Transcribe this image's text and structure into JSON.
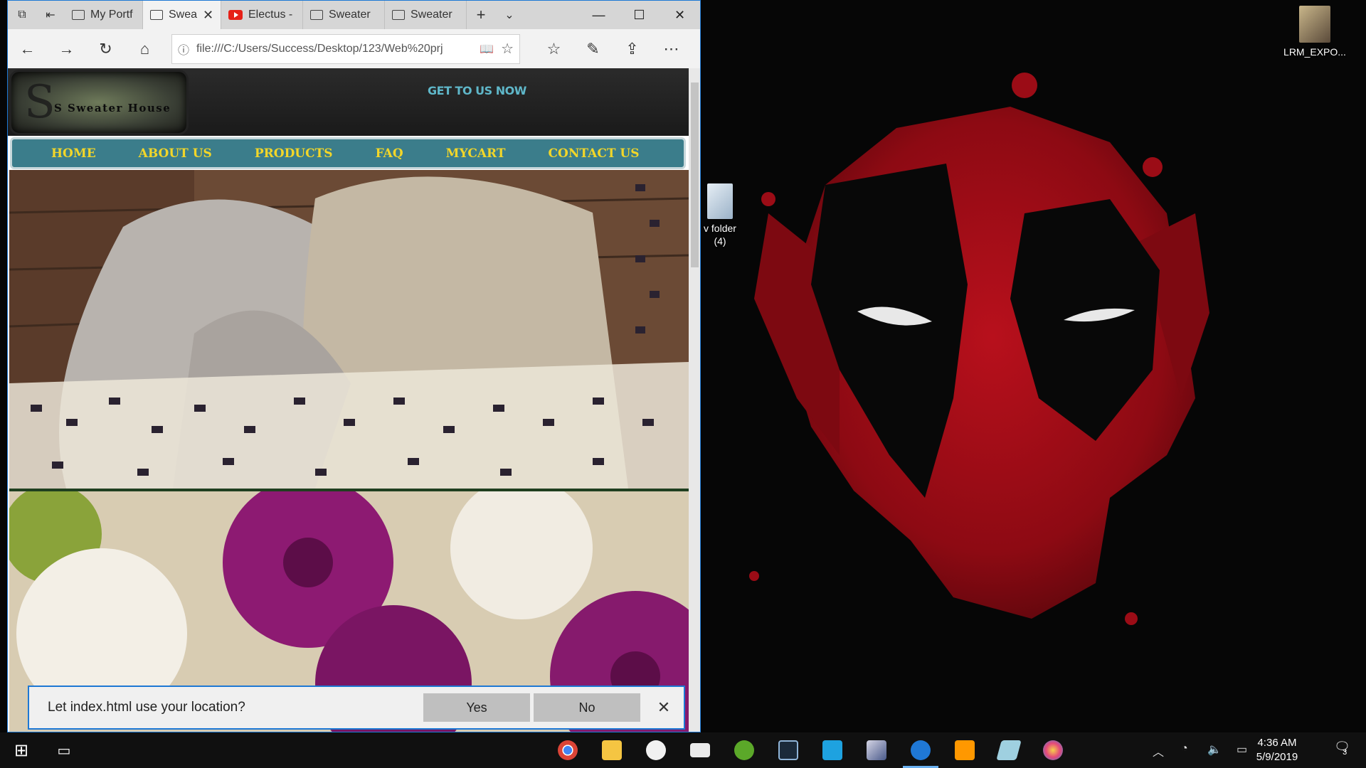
{
  "browser": {
    "tabs": [
      {
        "title": "My Portf",
        "icon": "page-icon",
        "active": false
      },
      {
        "title": "Swea",
        "icon": "page-icon",
        "active": true
      },
      {
        "title": "Electus -",
        "icon": "youtube-icon",
        "active": false
      },
      {
        "title": "Sweater",
        "icon": "page-icon",
        "active": false
      },
      {
        "title": "Sweater",
        "icon": "page-icon",
        "active": false
      }
    ],
    "address": "file:///C:/Users/Success/Desktop/123/Web%20prj"
  },
  "site": {
    "logo_text": "S Sweater House",
    "tagline": "GET TO US NOW",
    "menu": [
      "HOME",
      "ABOUT US",
      "PRODUCTS",
      "FAQ",
      "MYCART",
      "CONTACT US"
    ]
  },
  "permission": {
    "message": "Let index.html use your location?",
    "yes": "Yes",
    "no": "No"
  },
  "desktop": {
    "icons": [
      {
        "label": "LRM_EXPO..."
      },
      {
        "label": "v folder",
        "sublabel": "(4)"
      }
    ]
  },
  "taskbar": {
    "time": "4:36 AM",
    "date": "5/9/2019",
    "notification_count": "3",
    "apps": [
      "chrome-icon",
      "file-explorer-icon",
      "itunes-icon",
      "mail-icon",
      "utorrent-icon",
      "lightroom-icon",
      "app-icon",
      "game-icon",
      "edge-icon",
      "sublime-text-icon",
      "notes-icon",
      "paint-icon"
    ]
  },
  "colors": {
    "accent": "#1d78d4",
    "site_nav": "#3b7d8b",
    "menu_text": "#f2d629",
    "tagline": "#5fb7c9"
  }
}
